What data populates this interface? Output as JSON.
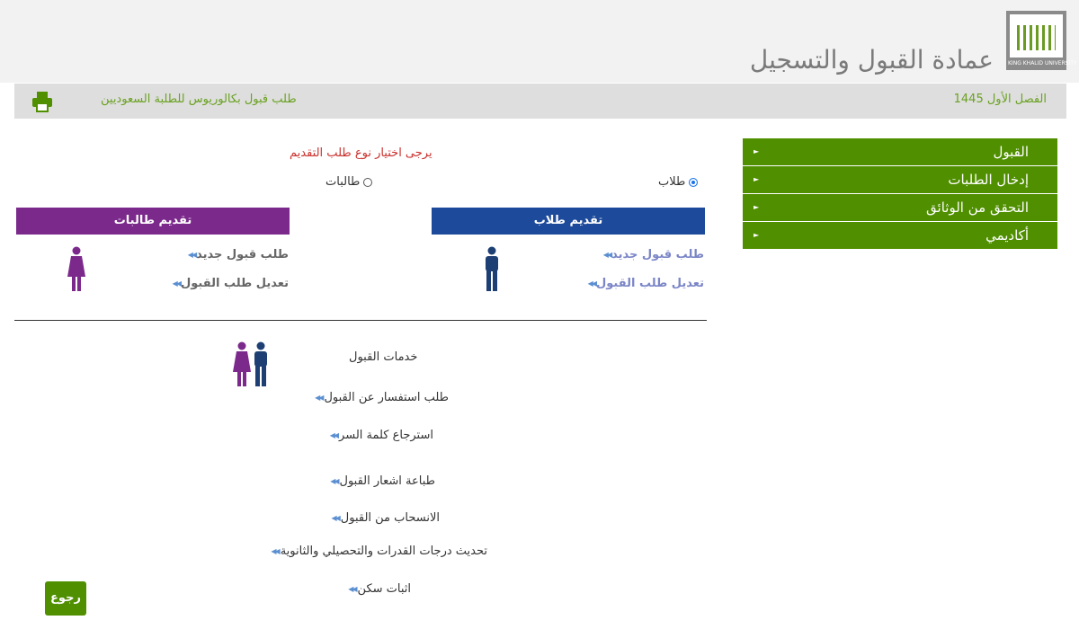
{
  "header": {
    "title": "عمادة القبول والتسجيل",
    "logo_text": "KING KHALID UNIVERSITY",
    "logo_icon": "university-logo"
  },
  "subbar": {
    "semester": "الفصل الأول 1445",
    "request_type": "طلب قبول بكالوريوس للطلبة السعوديين",
    "print_icon": "printer-icon"
  },
  "sidebar": {
    "items": [
      {
        "label": "القبول"
      },
      {
        "label": "إدخال الطلبات"
      },
      {
        "label": "التحقق من الوثائق"
      },
      {
        "label": "أكاديمي"
      }
    ]
  },
  "main": {
    "prompt": "يرجى اختيار نوع طلب التقديم",
    "radio_male": "طلاب",
    "radio_female": "طالبات",
    "selected": "طلاب",
    "male_panel": {
      "title": "تقديم طلاب",
      "links": [
        "طلب قبول جديد",
        "تعديل طلب القبول"
      ]
    },
    "female_panel": {
      "title": "تقديم طالبات",
      "links": [
        "طلب قبول جديد",
        "تعديل طلب القبول"
      ]
    },
    "services_title": "خدمات القبول",
    "services": [
      "طلب استفسار عن القبول",
      "استرجاع كلمة السر",
      "طباعة اشعار القبول",
      "الانسحاب من القبول",
      "تحديث درجات القدرات والتحصيلي والثانوية",
      "اثبات سكن"
    ],
    "back_label": "رجوع"
  },
  "colors": {
    "accent_green": "#4f8f00",
    "male_blue": "#1d4a9a",
    "female_purple": "#7b2a8c",
    "semester_green": "#6aa121"
  }
}
